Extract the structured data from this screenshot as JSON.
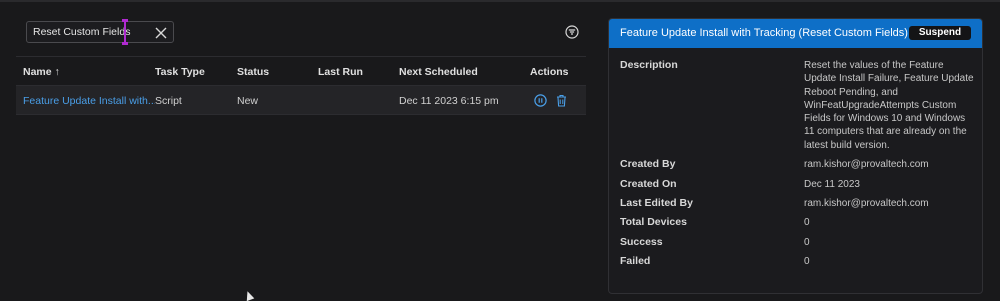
{
  "search": {
    "value": "Reset Custom Fields"
  },
  "table": {
    "headers": {
      "name": "Name ↑",
      "task_type": "Task Type",
      "status": "Status",
      "last_run": "Last Run",
      "next_scheduled": "Next Scheduled",
      "actions": "Actions"
    },
    "rows": [
      {
        "name": "Feature Update Install with...",
        "task_type": "Script",
        "status": "New",
        "last_run": "",
        "next_scheduled": "Dec 11 2023 6:15 pm"
      }
    ]
  },
  "panel": {
    "title": "Feature Update Install with Tracking (Reset Custom Fields)",
    "suspend_label": "Suspend",
    "fields": {
      "description_label": "Description",
      "description_value": "Reset the values of the Feature Update Install Failure, Feature Update Reboot Pending, and WinFeatUpgradeAttempts Custom Fields for Windows 10 and Windows 11 computers that are already on the latest build version.",
      "created_by_label": "Created By",
      "created_by_value": "ram.kishor@provaltech.com",
      "created_on_label": "Created On",
      "created_on_value": "Dec 11 2023",
      "last_edited_by_label": "Last Edited By",
      "last_edited_by_value": "ram.kishor@provaltech.com",
      "total_devices_label": "Total Devices",
      "total_devices_value": "0",
      "success_label": "Success",
      "success_value": "0",
      "failed_label": "Failed",
      "failed_value": "0"
    }
  },
  "colors": {
    "accent": "#0e6fc7",
    "link": "#4a9fe8",
    "background": "#19191b"
  },
  "icons": {
    "clear": "close-icon",
    "filter": "filter-icon",
    "pause": "pause-circle-icon",
    "delete": "trash-icon"
  }
}
